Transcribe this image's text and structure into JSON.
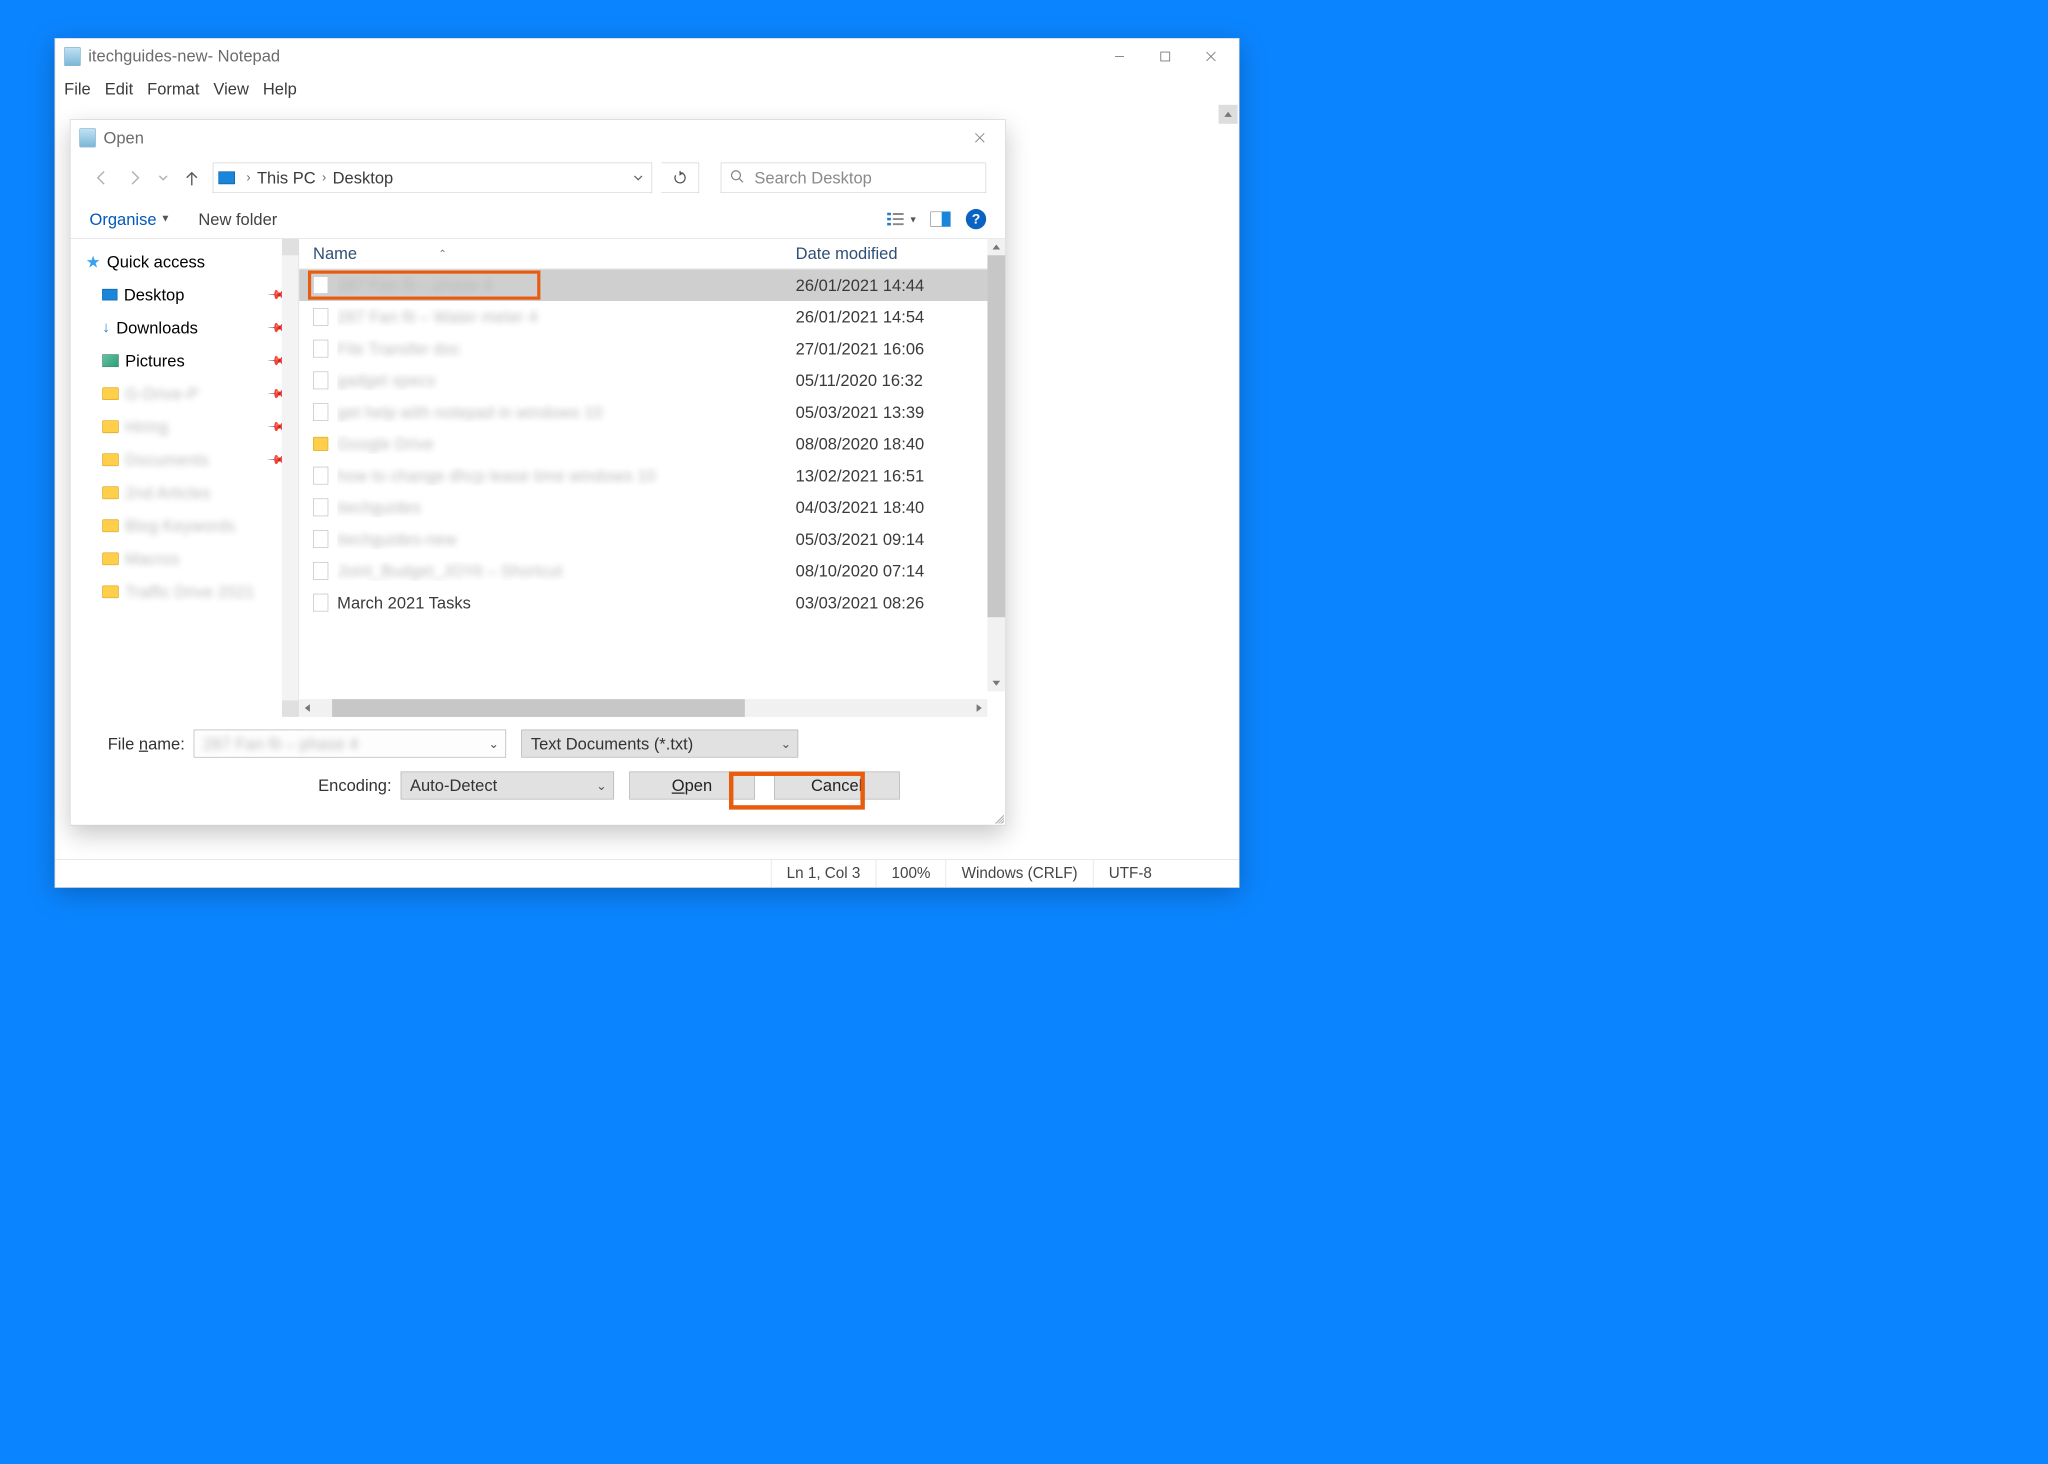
{
  "notepad": {
    "title_suffix": " - Notepad",
    "doc_name": "itechguides-new",
    "menubar": [
      "File",
      "Edit",
      "Format",
      "View",
      "Help"
    ],
    "status": {
      "pos": "Ln 1, Col 3",
      "zoom": "100%",
      "eol": "Windows (CRLF)",
      "enc": "UTF-8"
    }
  },
  "dialog": {
    "title": "Open",
    "breadcrumb": [
      "This PC",
      "Desktop"
    ],
    "search_placeholder": "Search Desktop",
    "toolbar": {
      "organise": "Organise",
      "new_folder": "New folder"
    },
    "columns": {
      "name": "Name",
      "date": "Date modified"
    },
    "nav_tree": [
      {
        "label": "Quick access",
        "icon": "star",
        "indent": false,
        "pinned": false,
        "blurred": false
      },
      {
        "label": "Desktop",
        "icon": "monitor",
        "indent": true,
        "pinned": true,
        "blurred": false
      },
      {
        "label": "Downloads",
        "icon": "download",
        "indent": true,
        "pinned": true,
        "blurred": false
      },
      {
        "label": "Pictures",
        "icon": "picture",
        "indent": true,
        "pinned": true,
        "blurred": false
      },
      {
        "label": "G-Drive-P",
        "icon": "folder",
        "indent": true,
        "pinned": true,
        "blurred": true
      },
      {
        "label": "Hiring",
        "icon": "folder",
        "indent": true,
        "pinned": true,
        "blurred": true
      },
      {
        "label": "Documents",
        "icon": "folder",
        "indent": true,
        "pinned": true,
        "blurred": true
      },
      {
        "label": "2nd Articles",
        "icon": "folder",
        "indent": true,
        "pinned": false,
        "blurred": true
      },
      {
        "label": "Blog Keywords",
        "icon": "folder",
        "indent": true,
        "pinned": false,
        "blurred": true
      },
      {
        "label": "Macros",
        "icon": "folder",
        "indent": true,
        "pinned": false,
        "blurred": true
      },
      {
        "label": "Traffic Drive 2021",
        "icon": "folder",
        "indent": true,
        "pinned": false,
        "blurred": true
      }
    ],
    "files": [
      {
        "name": "287 Fan fit – phase 4",
        "date": "26/01/2021 14:44",
        "selected": true,
        "folder": false,
        "blurred": true
      },
      {
        "name": "287 Fan fit – Water meter 4",
        "date": "26/01/2021 14:54",
        "selected": false,
        "folder": false,
        "blurred": true
      },
      {
        "name": "File Transfer doc",
        "date": "27/01/2021 16:06",
        "selected": false,
        "folder": false,
        "blurred": true
      },
      {
        "name": "gadget specs",
        "date": "05/11/2020 16:32",
        "selected": false,
        "folder": false,
        "blurred": true
      },
      {
        "name": "get help with notepad in windows 10",
        "date": "05/03/2021 13:39",
        "selected": false,
        "folder": false,
        "blurred": true
      },
      {
        "name": "Google Drive",
        "date": "08/08/2020 18:40",
        "selected": false,
        "folder": true,
        "blurred": true
      },
      {
        "name": "how to change dhcp lease time windows 10",
        "date": "13/02/2021 16:51",
        "selected": false,
        "folder": false,
        "blurred": true
      },
      {
        "name": "itechguides",
        "date": "04/03/2021 18:40",
        "selected": false,
        "folder": false,
        "blurred": true
      },
      {
        "name": "itechguides-new",
        "date": "05/03/2021 09:14",
        "selected": false,
        "folder": false,
        "blurred": true
      },
      {
        "name": "Joint_Budget_JOYit – Shortcut",
        "date": "08/10/2020 07:14",
        "selected": false,
        "folder": false,
        "blurred": true
      },
      {
        "name": "March 2021 Tasks",
        "date": "03/03/2021 08:26",
        "selected": false,
        "folder": false,
        "blurred": false
      }
    ],
    "footer": {
      "filename_label_pre": "File ",
      "filename_label_ul": "n",
      "filename_label_post": "ame:",
      "filename_value": "287 Fan fit – phase 4",
      "filetype": "Text Documents (*.txt)",
      "encoding_label": "Encoding:",
      "encoding_value": "Auto-Detect",
      "open_pre": "",
      "open_ul": "O",
      "open_post": "pen",
      "cancel": "Cancel"
    }
  }
}
